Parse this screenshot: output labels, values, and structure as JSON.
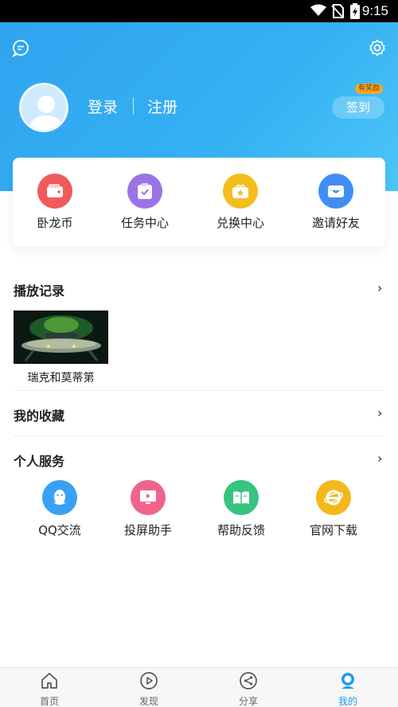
{
  "statusbar": {
    "time": "9:15"
  },
  "header": {
    "login_label": "登录",
    "register_label": "注册",
    "checkin_label": "签到",
    "reward_badge": "有奖励"
  },
  "quick_actions": [
    {
      "label": "卧龙币",
      "color": "#f05a5a"
    },
    {
      "label": "任务中心",
      "color": "#9b73e6"
    },
    {
      "label": "兑换中心",
      "color": "#f5bd1c"
    },
    {
      "label": "邀请好友",
      "color": "#3f8ff2"
    }
  ],
  "history": {
    "title": "播放记录",
    "items": [
      {
        "title": "瑞克和莫蒂第"
      }
    ]
  },
  "favorites": {
    "title": "我的收藏"
  },
  "services": {
    "title": "个人服务",
    "items": [
      {
        "label": "QQ交流",
        "color": "#3aa1f2"
      },
      {
        "label": "投屏助手",
        "color": "#f0648a"
      },
      {
        "label": "帮助反馈",
        "color": "#36c47e"
      },
      {
        "label": "官网下载",
        "color": "#f5b81a"
      }
    ]
  },
  "chevron": "›",
  "bottom_nav": [
    {
      "label": "首页",
      "active": false
    },
    {
      "label": "发现",
      "active": false
    },
    {
      "label": "分享",
      "active": false
    },
    {
      "label": "我的",
      "active": true
    }
  ]
}
